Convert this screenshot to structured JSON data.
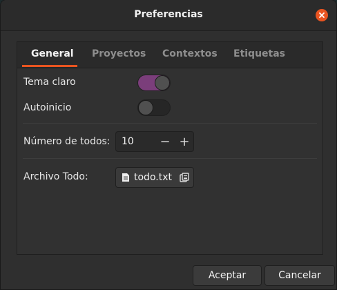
{
  "window": {
    "title": "Preferencias"
  },
  "tabs": [
    {
      "label": "General",
      "active": true
    },
    {
      "label": "Proyectos",
      "active": false
    },
    {
      "label": "Contextos",
      "active": false
    },
    {
      "label": "Etiquetas",
      "active": false
    }
  ],
  "general": {
    "light_theme": {
      "label": "Tema claro",
      "on": true
    },
    "autostart": {
      "label": "Autoinicio",
      "on": false
    },
    "todo_count": {
      "label": "Número de todos:",
      "value": "10",
      "decrement": "−",
      "increment": "+"
    },
    "todo_file": {
      "label": "Archivo Todo:",
      "file_name": "todo.txt",
      "file_icon": "document-icon",
      "browse_icon": "copy-icon"
    }
  },
  "footer": {
    "accept": "Aceptar",
    "cancel": "Cancelar"
  },
  "colors": {
    "accent": "#e95420",
    "switch_on": "#7b3e7b"
  }
}
